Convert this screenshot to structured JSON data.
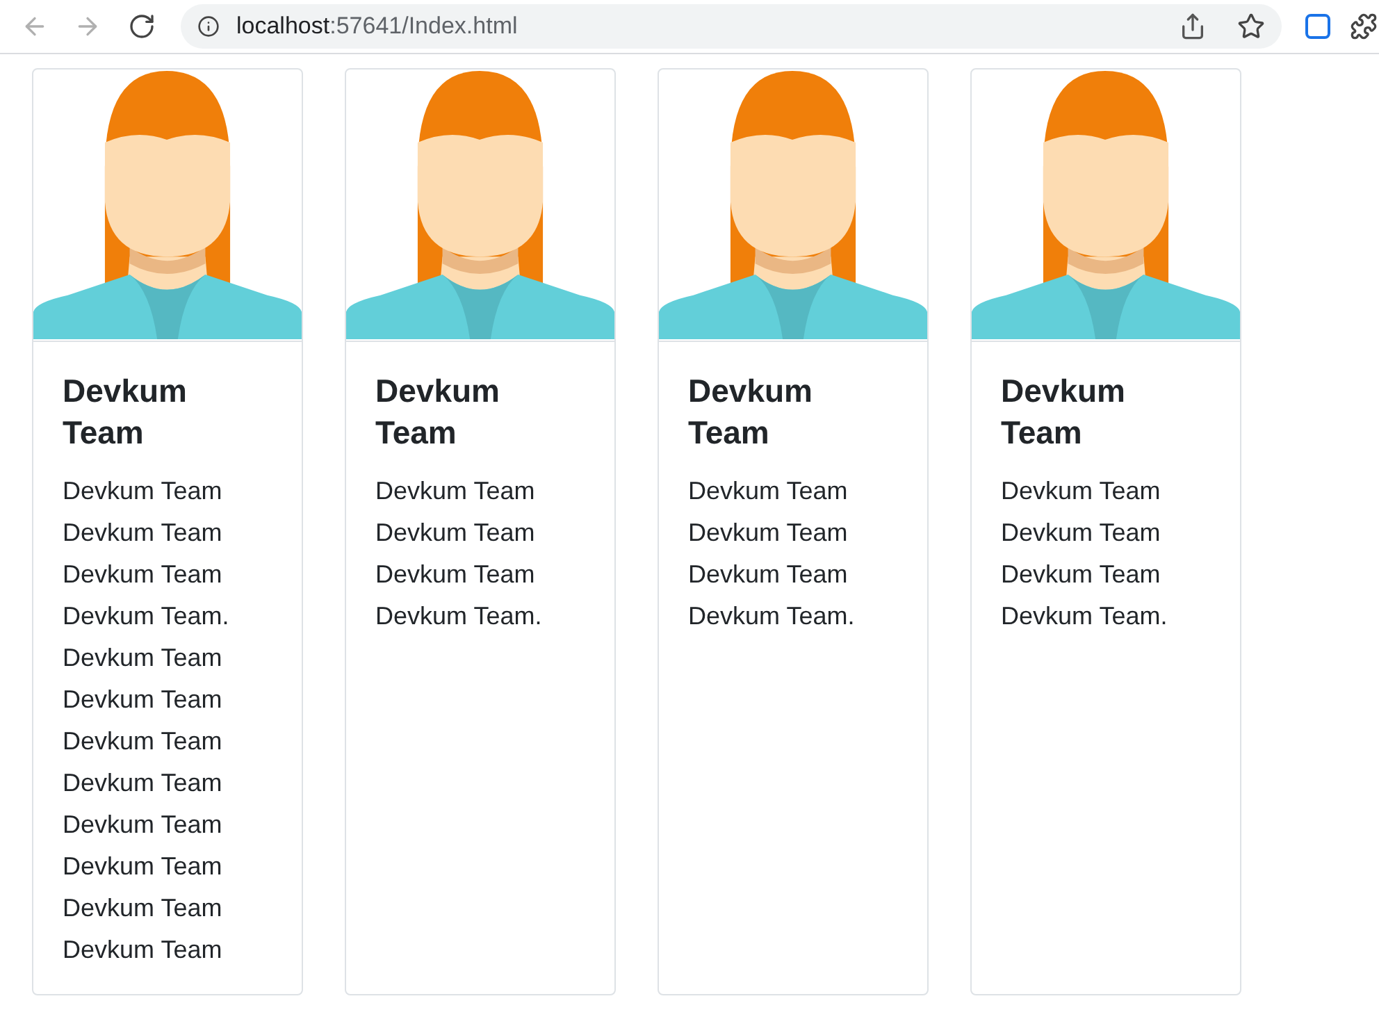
{
  "browser": {
    "url_host": "localhost",
    "url_path": ":57641/Index.html"
  },
  "cards": [
    {
      "title": "Devkum Team",
      "lines": [
        "Devkum Team",
        "Devkum Team",
        "Devkum Team",
        "Devkum Team.",
        "Devkum Team",
        "Devkum Team",
        "Devkum Team",
        "Devkum Team",
        "Devkum Team",
        "Devkum Team",
        "Devkum Team",
        "Devkum Team"
      ]
    },
    {
      "title": "Devkum Team",
      "lines": [
        "Devkum Team",
        "Devkum Team",
        "Devkum Team",
        "Devkum Team."
      ]
    },
    {
      "title": "Devkum Team",
      "lines": [
        "Devkum Team",
        "Devkum Team",
        "Devkum Team",
        "Devkum Team."
      ]
    },
    {
      "title": "Devkum Team",
      "lines": [
        "Devkum Team",
        "Devkum Team",
        "Devkum Team",
        "Devkum Team."
      ]
    }
  ]
}
